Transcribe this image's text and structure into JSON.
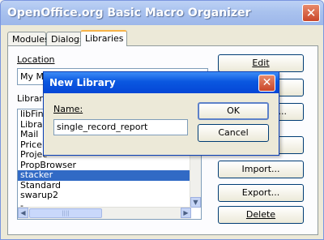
{
  "window": {
    "title": "OpenOffice.org Basic Macro Organizer",
    "close_glyph": "✕"
  },
  "tabs": [
    {
      "label": "Modules"
    },
    {
      "label": "Dialogs"
    },
    {
      "label": "Libraries"
    }
  ],
  "location": {
    "label": "Location",
    "value": "My Ma"
  },
  "library_list": {
    "label": "Library",
    "items": [
      "libFind",
      "Library",
      "Mail",
      "PriceL",
      "Projec",
      "PropBrowser",
      "stacker",
      "Standard",
      "swarup2",
      "-"
    ],
    "selected": "stacker"
  },
  "side_buttons": {
    "edit": "Edit",
    "b2": "",
    "b3": "...",
    "b4": "",
    "import": "Import...",
    "export": "Export...",
    "delete": "Delete"
  },
  "dialog": {
    "title": "New Library",
    "name_label": "Name:",
    "name_value": "single_record_report",
    "ok_label": "OK",
    "cancel_label": "Cancel",
    "close_glyph": "✕"
  },
  "scroll": {
    "up": "▲",
    "down": "▼",
    "left": "◀",
    "right": "▶",
    "grip": "||||"
  },
  "colors": {
    "selection": "#316ac5",
    "title_blue": "#0a57e0",
    "close_red": "#c9462a"
  }
}
